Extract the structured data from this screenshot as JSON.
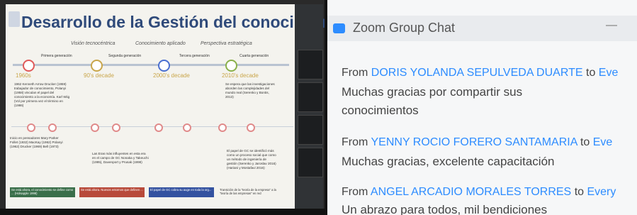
{
  "slide": {
    "title": "Desarrollo de la Gestión del conocimiento",
    "subtitles": [
      "Visión tecnocéntrica",
      "Conocimiento aplicado",
      "Perspectiva estratégica"
    ],
    "generations": [
      "Primera generación",
      "Segunda generación",
      "Tercera generación",
      "Cuarta generación"
    ],
    "decades": [
      "1960s",
      "90's decade",
      "2000's decade",
      "2010's decade"
    ],
    "col1_text": "1962 Kenneth Arrow Drucker (1959) trabajador de conocimiento, Polanyi (1958) vinculan el papel del conocimiento a la economía. Karl Wiig (Vol por primera vez el término en (1986)",
    "col1_bottom": "Inicio en pensadores Mary Parker Follet (1932) MacKay (1962) Polanyi (1962) Drucker (1969) Bell (1973)",
    "col3_bottom": "Las Eras más influyentes en esta era en el campo de GC Nonaka y Takeuchi (1995), Davenport y Prusak (1998)",
    "col5_text": "Se espera que las investigaciones aborden las complejidades del mundo real (Serenko y Bontis, 2013)",
    "col5_bottom": "El papel de GC se identificó más como un proceso social que como un método de ingeniería de gestión (Serenko y Jaroslav 2016) (Hariani y Mostafavi 2016)",
    "bands": [
      "Se está ahora, el conocimiento se define como ... (Holsapple 1998)",
      "Se está ahora. Nuevos entornos que definen ...",
      "El papel de GC cobra su auge en toda la org...",
      "Transición de la \"teoría de la empresa\" a la \"teoría de las empresas\" en red"
    ]
  },
  "chat": {
    "title": "Zoom Group Chat",
    "minimize": "—",
    "messages": [
      {
        "from_label": "From",
        "sender": "DORIS YOLANDA SEPULVEDA DUARTE",
        "to_label": "to",
        "recipient": "Eve",
        "lines": [
          "Muchas gracias por compartir sus",
          "conocimientos"
        ]
      },
      {
        "from_label": "From",
        "sender": "YENNY ROCIO FORERO SANTAMARIA",
        "to_label": "to",
        "recipient": "Eve",
        "lines": [
          "Muchas gracias, excelente capacitación"
        ]
      },
      {
        "from_label": "From",
        "sender": "ANGEL ARCADIO MORALES TORRES",
        "to_label": "to",
        "recipient": "Every",
        "lines": [
          "Un abrazo para todos, mil bendiciones"
        ]
      }
    ]
  },
  "colors": {
    "accent": "#2d8cff",
    "slide_title": "#2f4a7a"
  }
}
